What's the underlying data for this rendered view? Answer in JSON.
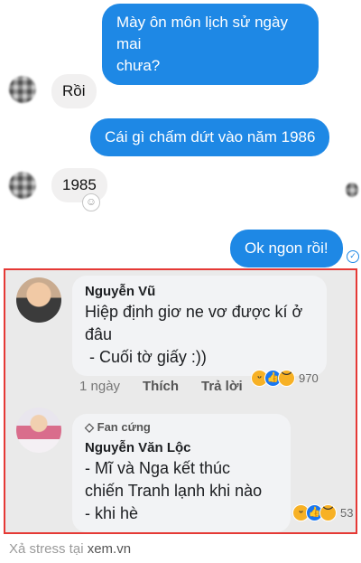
{
  "chat": {
    "messages": [
      {
        "side": "out",
        "text_line1": "Mày ôn môn lịch sử ngày mai",
        "text_line2": "chưa?"
      },
      {
        "side": "in",
        "text": "Rồi"
      },
      {
        "side": "out",
        "text": "Cái gì chấm dứt vào năm 1986"
      },
      {
        "side": "in",
        "text": "1985"
      },
      {
        "side": "out",
        "text": "Ok ngon rồi!"
      }
    ],
    "reaction_icon": "smiley-plus-icon",
    "seen_icon": "check-circle-icon"
  },
  "comments": [
    {
      "author": "Nguyễn Vũ",
      "line1": "Hiệp định giơ ne vơ được kí ở",
      "line2": "đâu",
      "line3": " - Cuối tờ giấy :))",
      "time": "1 ngày",
      "like": "Thích",
      "reply": "Trả lời",
      "reaction_count": "970"
    },
    {
      "badge": "Fan cứng",
      "author": "Nguyễn Văn Lộc",
      "line1": "- Mĩ và Nga kết thúc",
      "line2": "chiến Tranh lạnh khi nào",
      "line3": "- khi hè",
      "reaction_count": "53"
    }
  ],
  "watermark": {
    "prefix": "Xả stress tại ",
    "site": "xem.vn"
  },
  "colors": {
    "outgoing": "#1e88e5",
    "incoming": "#f1f0f0",
    "frame": "#e53935"
  }
}
